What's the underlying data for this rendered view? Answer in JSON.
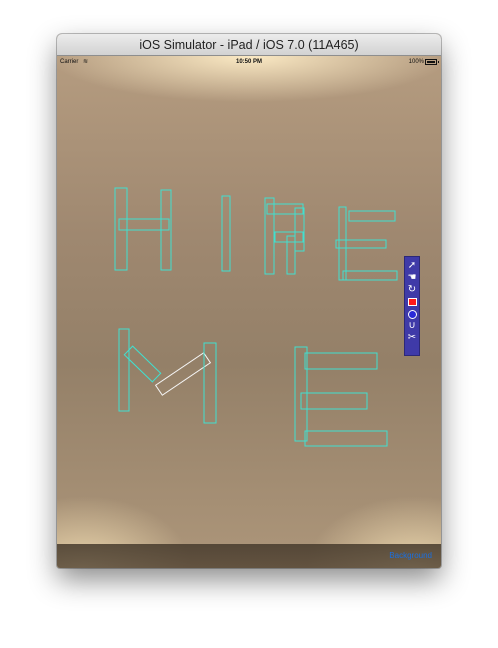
{
  "window": {
    "title": "iOS Simulator - iPad / iOS 7.0 (11A465)"
  },
  "status_bar": {
    "carrier": "Carrier",
    "wifi_icon": "wifi-icon",
    "time": "10:50 PM",
    "battery_percent": "100%",
    "battery_level": 1.0
  },
  "canvas": {
    "shape_stroke_color": "#40e0d0",
    "selected_shape_stroke_color": "#f5f5f5",
    "drawn_text": "HIRE ME"
  },
  "tool_palette": {
    "background_color": "#3f3aa8",
    "tools": [
      {
        "name": "select-arrow-icon",
        "glyph": "➚"
      },
      {
        "name": "hand-drag-icon",
        "glyph": "☚"
      },
      {
        "name": "rotate-icon",
        "glyph": "↻"
      },
      {
        "name": "rectangle-tool-icon",
        "glyph": ""
      },
      {
        "name": "circle-tool-icon",
        "glyph": ""
      },
      {
        "name": "magnet-icon",
        "glyph": "∪"
      },
      {
        "name": "scissors-icon",
        "glyph": "✂"
      }
    ]
  },
  "toolbar": {
    "background_button_label": "Background"
  }
}
